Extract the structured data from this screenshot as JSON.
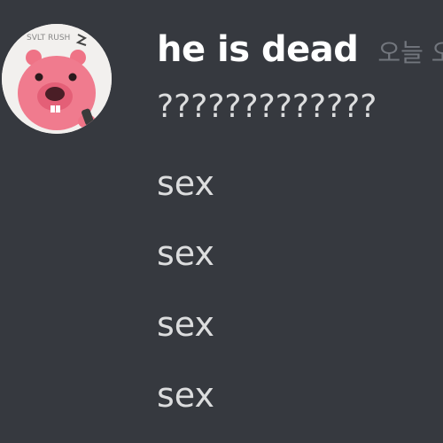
{
  "author": {
    "name": "he is dead",
    "avatar_icon": "pink-beaver-avatar",
    "avatar_caption": "SVLT RUSH",
    "name_color": "#ffffff"
  },
  "timestamp": "오늘 오",
  "messages": [
    {
      "text": "?????????????"
    },
    {
      "text": "sex"
    },
    {
      "text": "sex"
    },
    {
      "text": "sex"
    },
    {
      "text": "sex"
    }
  ],
  "colors": {
    "background": "#36393f",
    "message_text": "#dcddde",
    "timestamp_text": "#72767d"
  }
}
